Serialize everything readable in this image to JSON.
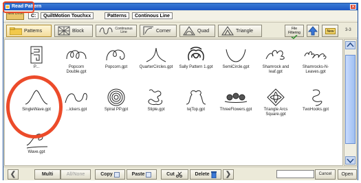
{
  "window": {
    "title": "Read Pattern",
    "close_glyph": "✕"
  },
  "pathbar": {
    "new_drive_label": "New Drive",
    "crumbs": [
      "C:",
      "QuiltMotion Touchxx",
      "Patterns",
      "Continous Line"
    ]
  },
  "categories": {
    "tabs": [
      {
        "label": "Patterns",
        "icon": "folder-icon",
        "active": true
      },
      {
        "label": "Block",
        "icon": "block-icon"
      },
      {
        "label": "Continuous Line",
        "icon": "continuous-line-icon"
      },
      {
        "label": "Corner",
        "icon": "corner-icon"
      },
      {
        "label": "Quad",
        "icon": "quad-icon"
      },
      {
        "label": "Triangle",
        "icon": "triangle-icon"
      }
    ],
    "file_filtering_label": "File Filtering",
    "up_icon": "up-arrow-icon",
    "new_label": "New",
    "page_counter": "3-3"
  },
  "files": [
    {
      "name": "P...",
      "icon": "pattern-maze"
    },
    {
      "name": "Popcorn Double.gpt",
      "icon": "pattern-popcorn-double"
    },
    {
      "name": "Popcorn.gpt",
      "icon": "pattern-popcorn"
    },
    {
      "name": "QuarterCircles.gpt",
      "icon": "pattern-quartercircles"
    },
    {
      "name": "Sally Pattern 1.gpt",
      "icon": "pattern-sally"
    },
    {
      "name": "SemiCircle.gpt",
      "icon": "pattern-semicircle"
    },
    {
      "name": "Shamrock and leaf.gpt",
      "icon": "pattern-shamrock-leaf"
    },
    {
      "name": "Shamrocks-N-Leaves.gpt",
      "icon": "pattern-shamrocks-leaves"
    },
    {
      "name": "SingleWave.gpt",
      "icon": "pattern-singlewave"
    },
    {
      "name": "...ickers.gpt",
      "icon": "pattern-snickers"
    },
    {
      "name": "Spiral PP.gpt",
      "icon": "pattern-spiral"
    },
    {
      "name": "Stiple.gpt",
      "icon": "pattern-stiple"
    },
    {
      "name": "tejTop.gpt",
      "icon": "pattern-tejtop"
    },
    {
      "name": "ThreeFlowers.gpt",
      "icon": "pattern-threeflowers"
    },
    {
      "name": "Triangle Arcs Square.gpt",
      "icon": "pattern-trianglearcs"
    },
    {
      "name": "TwoHooks.gpt",
      "icon": "pattern-twohooks"
    },
    {
      "name": "Wave.gpt",
      "icon": "pattern-wave"
    }
  ],
  "bottombar": {
    "prev_glyph": "❮",
    "next_glyph": "❯",
    "multi": "Multi",
    "allnone": "All/None",
    "copy": "Copy",
    "paste": "Paste",
    "cut": "Cut",
    "delete": "Delete",
    "cancel": "Cancel",
    "open": "Open"
  },
  "colors": {
    "annotation": "#ec4b2a",
    "titlebar": "#1d57c4"
  }
}
